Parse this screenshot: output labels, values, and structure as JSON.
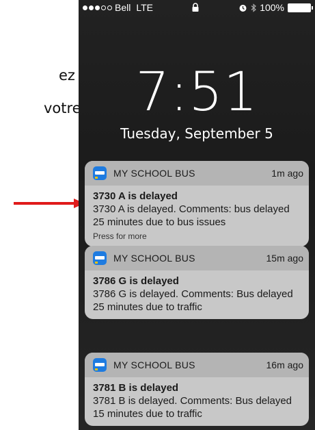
{
  "side_text": [
    "ez sur",
    "votre"
  ],
  "status_bar": {
    "carrier": "Bell",
    "network": "LTE",
    "battery": "100%",
    "icons": [
      "signal-dots-icon",
      "lock-icon",
      "alarm-icon",
      "bluetooth-icon",
      "battery-icon"
    ]
  },
  "lock_screen": {
    "time": "7:51",
    "date": "Tuesday, September 5"
  },
  "notifications": [
    {
      "app": "MY SCHOOL BUS",
      "ago": "1m ago",
      "title": "3730 A is delayed",
      "body": "3730 A is delayed. Comments: bus delayed 25 minutes due to bus issues",
      "more": "Press for more"
    },
    {
      "app": "MY SCHOOL BUS",
      "ago": "15m ago",
      "title": "3786 G is delayed",
      "body": "3786 G is delayed. Comments: Bus delayed 25 minutes due to traffic"
    },
    {
      "app": "MY SCHOOL BUS",
      "ago": "16m ago",
      "title": "3781 B is delayed",
      "body": "3781 B is delayed. Comments: Bus delayed 15 minutes due to traffic"
    }
  ],
  "colors": {
    "arrow": "#e01b1b",
    "app_icon": "#1e7be0",
    "notification_bg": "#c8c8c8",
    "notification_header": "#b4b4b4"
  }
}
